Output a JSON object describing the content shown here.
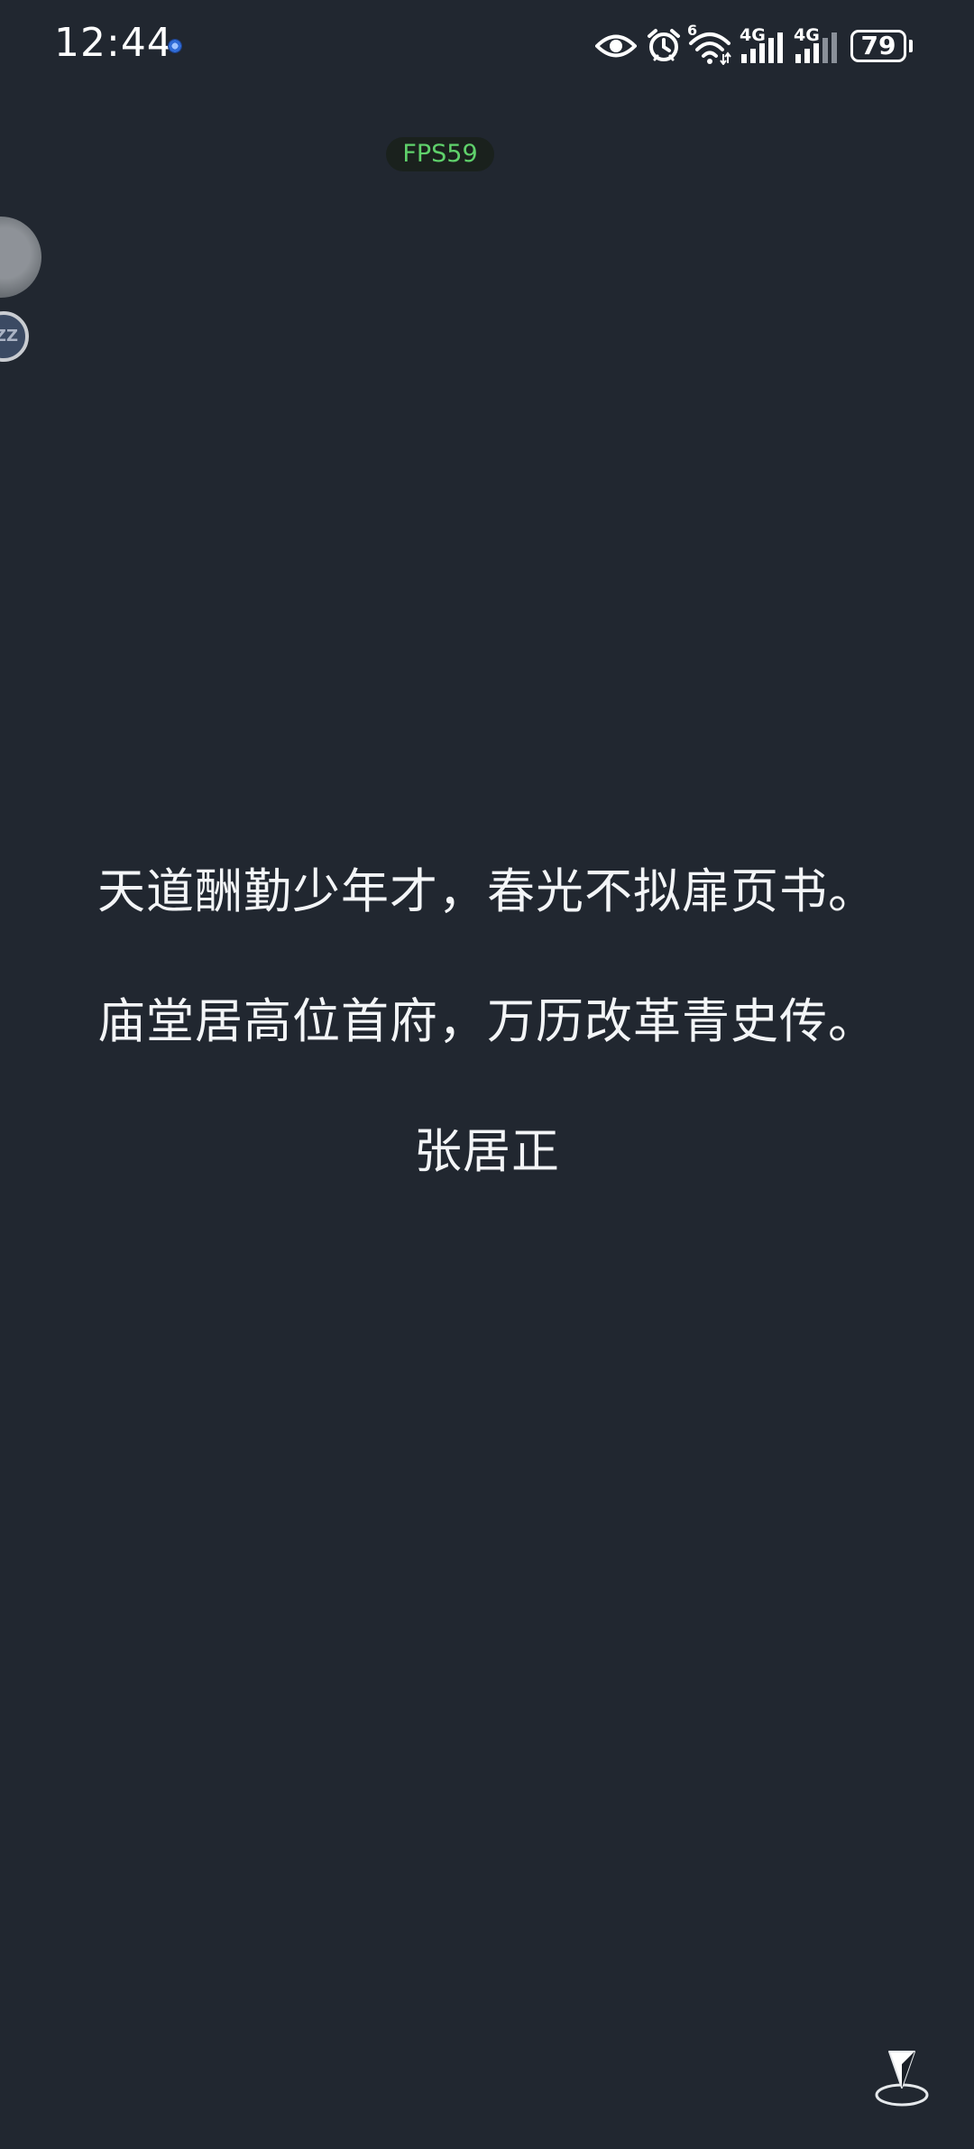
{
  "status_bar": {
    "time": "12:44",
    "battery": "79",
    "network_1": "4G",
    "network_2": "4G",
    "wifi_badge": "6"
  },
  "overlay": {
    "fps": "FPS59",
    "bubble_text": "ZZ"
  },
  "poem": {
    "line1": "天道酬勤少年才，春光不拟扉页书。",
    "line2": "庙堂居高位首府，万历改革青史传。",
    "author": "张居正"
  },
  "icons": {
    "eye": "eye-icon",
    "alarm": "alarm-icon",
    "wifi": "wifi-icon",
    "signal": "signal-icon",
    "pointer": "location-pointer-icon"
  },
  "colors": {
    "background": "#212730",
    "fps_text": "#5fd16b",
    "text": "#f3f5f7"
  }
}
